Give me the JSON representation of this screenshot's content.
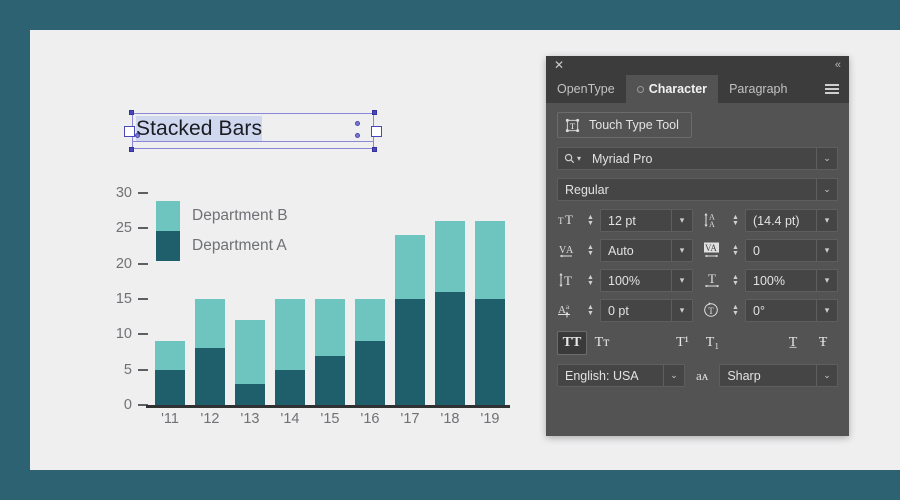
{
  "canvas": {
    "background_color": "#efeff0",
    "outer_color": "#2c6272"
  },
  "artwork": {
    "title": "Stacked Bars",
    "title_selected": true
  },
  "chart_data": {
    "type": "bar",
    "subtype": "stacked",
    "title": "Stacked Bars",
    "xlabel": "",
    "ylabel": "",
    "categories": [
      "'11",
      "'12",
      "'13",
      "'14",
      "'15",
      "'16",
      "'17",
      "'18",
      "'19"
    ],
    "series": [
      {
        "name": "Department A",
        "color": "#1f5f6b",
        "values": [
          5,
          8,
          3,
          5,
          7,
          9,
          15,
          16,
          15
        ]
      },
      {
        "name": "Department B",
        "color": "#6ec4be",
        "values": [
          4,
          7,
          9,
          10,
          8,
          6,
          9,
          10,
          11
        ]
      }
    ],
    "totals": [
      9,
      15,
      12,
      15,
      15,
      15,
      24,
      26,
      26
    ],
    "ylim": [
      0,
      30
    ],
    "yticks": [
      30,
      25,
      20,
      15,
      10,
      5,
      0
    ],
    "ytick_labels": [
      "30",
      "25",
      "20",
      "15",
      "10",
      "5",
      "0"
    ],
    "grid": false,
    "legend_position": "top-left",
    "legend": [
      "Department B",
      "Department A"
    ]
  },
  "panel": {
    "close_icon": "✕",
    "collapse_icon": "«",
    "tabs": [
      {
        "label": "OpenType",
        "active": false,
        "has_dot": false
      },
      {
        "label": "Character",
        "active": true,
        "has_dot": true
      },
      {
        "label": "Paragraph",
        "active": false,
        "has_dot": false
      }
    ],
    "menu_icon": "hamburger-icon",
    "touch_type_tool": "Touch Type Tool",
    "font_family": {
      "value": "Myriad Pro",
      "search_icon": "search-icon",
      "caret": "⌄"
    },
    "font_style": {
      "value": "Regular",
      "caret": "⌄"
    },
    "controls": [
      {
        "name": "font-size",
        "glyph": "TТ",
        "value": "12 pt"
      },
      {
        "name": "leading",
        "glyph": "A̲A",
        "value": "(14.4 pt)"
      },
      {
        "name": "kerning",
        "glyph": "V̲A",
        "value": "Auto"
      },
      {
        "name": "tracking",
        "glyph": "VA",
        "value": "0"
      },
      {
        "name": "vertical-scale",
        "glyph": "T",
        "value": "100%"
      },
      {
        "name": "horizontal-scale",
        "glyph": "T",
        "value": "100%"
      },
      {
        "name": "baseline-shift",
        "glyph": "Aª",
        "value": "0 pt"
      },
      {
        "name": "character-rotation",
        "glyph": "T",
        "value": "0°"
      }
    ],
    "style_buttons": [
      {
        "name": "all-caps",
        "label": "TT",
        "active": true
      },
      {
        "name": "small-caps",
        "label": "Tᴛ",
        "active": false
      },
      {
        "name": "superscript",
        "label": "T¹",
        "active": false
      },
      {
        "name": "subscript",
        "label": "T₁",
        "active": false
      },
      {
        "name": "underline",
        "label": "T̲",
        "active": false
      },
      {
        "name": "strikethrough",
        "label": "Ŧ",
        "active": false
      }
    ],
    "language": {
      "value": "English: USA",
      "caret": "⌄"
    },
    "anti_aliasing": {
      "glyph": "aᴀ",
      "value": "Sharp",
      "caret": "⌄"
    }
  }
}
